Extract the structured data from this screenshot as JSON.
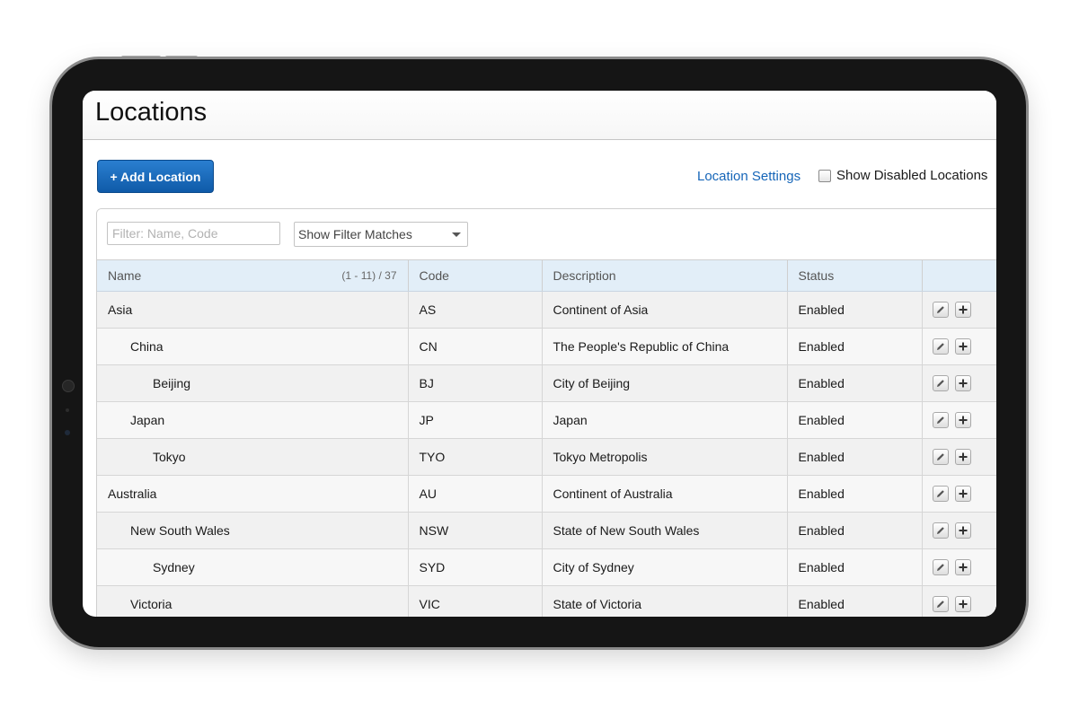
{
  "page": {
    "title": "Locations"
  },
  "toolbar": {
    "add_label": "+ Add Location",
    "settings_link": "Location Settings",
    "show_disabled_label": "Show Disabled Locations",
    "show_disabled_checked": false
  },
  "filter": {
    "placeholder": "Filter: Name, Code",
    "value": "",
    "mode_selected": "Show Filter Matches"
  },
  "table": {
    "columns": {
      "name": "Name",
      "count": "(1 - 11) / 37",
      "code": "Code",
      "description": "Description",
      "status": "Status",
      "actions": ""
    },
    "rows": [
      {
        "name": "Asia",
        "level": 0,
        "code": "AS",
        "description": "Continent of Asia",
        "status": "Enabled"
      },
      {
        "name": "China",
        "level": 1,
        "code": "CN",
        "description": "The People's Republic of China",
        "status": "Enabled"
      },
      {
        "name": "Beijing",
        "level": 2,
        "code": "BJ",
        "description": "City of Beijing",
        "status": "Enabled"
      },
      {
        "name": "Japan",
        "level": 1,
        "code": "JP",
        "description": "Japan",
        "status": "Enabled"
      },
      {
        "name": "Tokyo",
        "level": 2,
        "code": "TYO",
        "description": "Tokyo Metropolis",
        "status": "Enabled"
      },
      {
        "name": "Australia",
        "level": 0,
        "code": "AU",
        "description": "Continent of Australia",
        "status": "Enabled"
      },
      {
        "name": "New South Wales",
        "level": 1,
        "code": "NSW",
        "description": "State of New South Wales",
        "status": "Enabled"
      },
      {
        "name": "Sydney",
        "level": 2,
        "code": "SYD",
        "description": "City of Sydney",
        "status": "Enabled"
      },
      {
        "name": "Victoria",
        "level": 1,
        "code": "VIC",
        "description": "State of Victoria",
        "status": "Enabled"
      }
    ],
    "row_actions": {
      "edit_icon": "pencil-icon",
      "add_icon": "plus-icon"
    }
  },
  "colors": {
    "primary_button": "#1565b8",
    "link": "#1565b8",
    "header_row": "#e2eef8"
  }
}
